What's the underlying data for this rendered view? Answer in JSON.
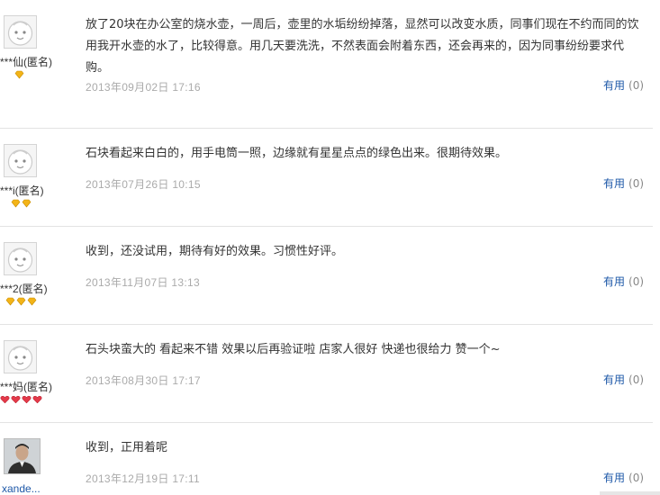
{
  "reviews": [
    {
      "username": "***仙(匿名)",
      "avatar_icon": "default-face-avatar",
      "badge_type": "yellow-diamond",
      "badge_count": 1,
      "content": "放了20块在办公室的烧水壶，一周后，壶里的水垢纷纷掉落，显然可以改变水质，同事们现在不约而同的饮用我开水壶的水了，比较得意。用几天要洗洗，不然表面会附着东西，还会再来的，因为同事纷纷要求代购。",
      "date": "2013年09月02日 17:16",
      "useful_label": "有用",
      "useful_count": "(0)"
    },
    {
      "username": "***i(匿名)",
      "avatar_icon": "default-face-avatar",
      "badge_type": "yellow-diamond",
      "badge_count": 2,
      "content": "石块看起来白白的，用手电筒一照，边缘就有星星点点的绿色出来。很期待效果。",
      "date": "2013年07月26日 10:15",
      "useful_label": "有用",
      "useful_count": "(0)"
    },
    {
      "username": "***2(匿名)",
      "avatar_icon": "default-face-avatar",
      "badge_type": "yellow-diamond",
      "badge_count": 3,
      "content": "收到，还没试用，期待有好的效果。习惯性好评。",
      "date": "2013年11月07日 13:13",
      "useful_label": "有用",
      "useful_count": "(0)"
    },
    {
      "username": "***妈(匿名)",
      "avatar_icon": "default-face-avatar",
      "badge_type": "red-heart",
      "badge_count": 4,
      "content": "石头块蛮大的 看起来不错 效果以后再验证啦 店家人很好 快递也很给力 赞一个~",
      "date": "2013年08月30日 17:17",
      "useful_label": "有用",
      "useful_count": "(0)"
    },
    {
      "username": "xande...",
      "avatar_icon": "user-photo-avatar",
      "badge_type": "",
      "badge_count": 0,
      "content": "收到，正用着呢",
      "date": "2013年12月19日 17:11",
      "useful_label": "有用",
      "useful_count": "(0)"
    }
  ],
  "colors": {
    "link": "#1e58a8",
    "date": "#aaaaaa",
    "divider": "#e3e3e3",
    "yellow_diamond": "#f3b418",
    "red_heart": "#e33a4a"
  }
}
